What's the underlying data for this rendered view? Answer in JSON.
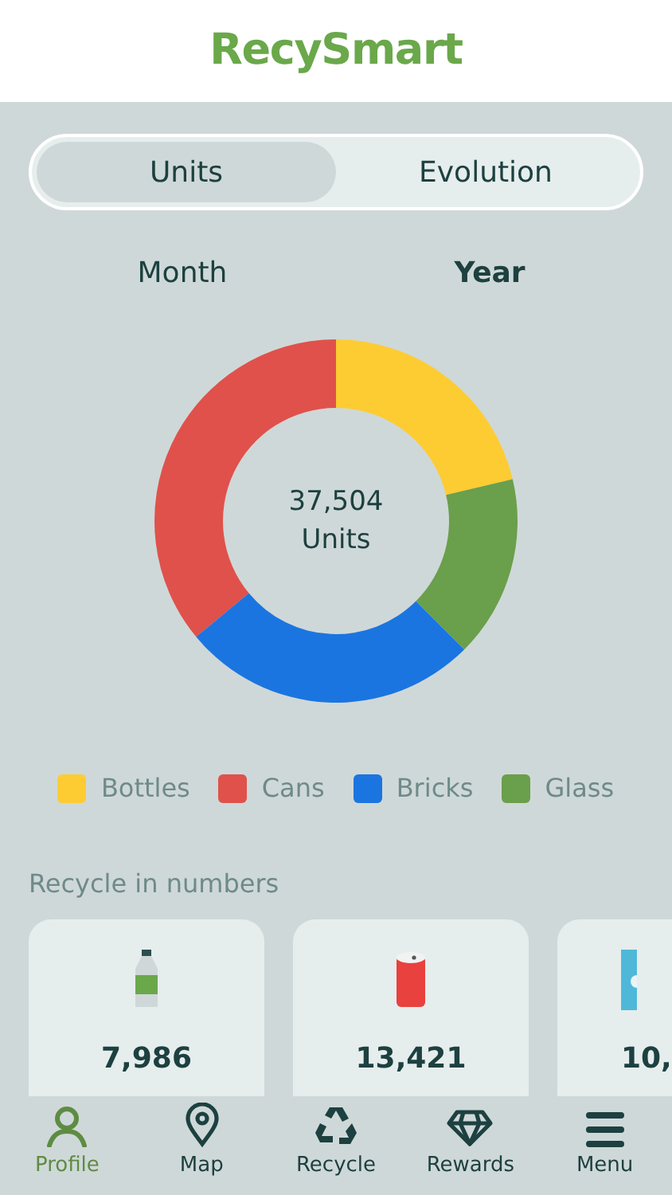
{
  "header": {
    "logo": "RecySmart"
  },
  "view_tabs": [
    {
      "label": "Units",
      "selected": true
    },
    {
      "label": "Evolution",
      "selected": false
    }
  ],
  "period_tabs": [
    {
      "label": "Month",
      "selected": false
    },
    {
      "label": "Year",
      "selected": true
    }
  ],
  "chart": {
    "total": "37,504",
    "unit": "Units",
    "chart_data": {
      "type": "donut",
      "categories": [
        "Bottles",
        "Cans",
        "Bricks",
        "Glass"
      ],
      "series": [
        {
          "values": [
            21.3,
            36.0,
            26.5,
            16.2
          ]
        }
      ],
      "colors": [
        "#fdcc33",
        "#e0514b",
        "#1b75e0",
        "#6a9f4b"
      ]
    }
  },
  "numbers": {
    "title": "Recycle in numbers",
    "cards": [
      {
        "kind": "bottle",
        "value": "7,986"
      },
      {
        "kind": "can",
        "value": "13,421"
      },
      {
        "kind": "brick",
        "value": "10,"
      }
    ]
  },
  "nav": [
    {
      "kind": "profile",
      "label": "Profile",
      "selected": true
    },
    {
      "kind": "map",
      "label": "Map",
      "selected": false
    },
    {
      "kind": "recycle",
      "label": "Recycle",
      "selected": false
    },
    {
      "kind": "rewards",
      "label": "Rewards",
      "selected": false
    },
    {
      "kind": "menu",
      "label": "Menu",
      "selected": false
    }
  ]
}
